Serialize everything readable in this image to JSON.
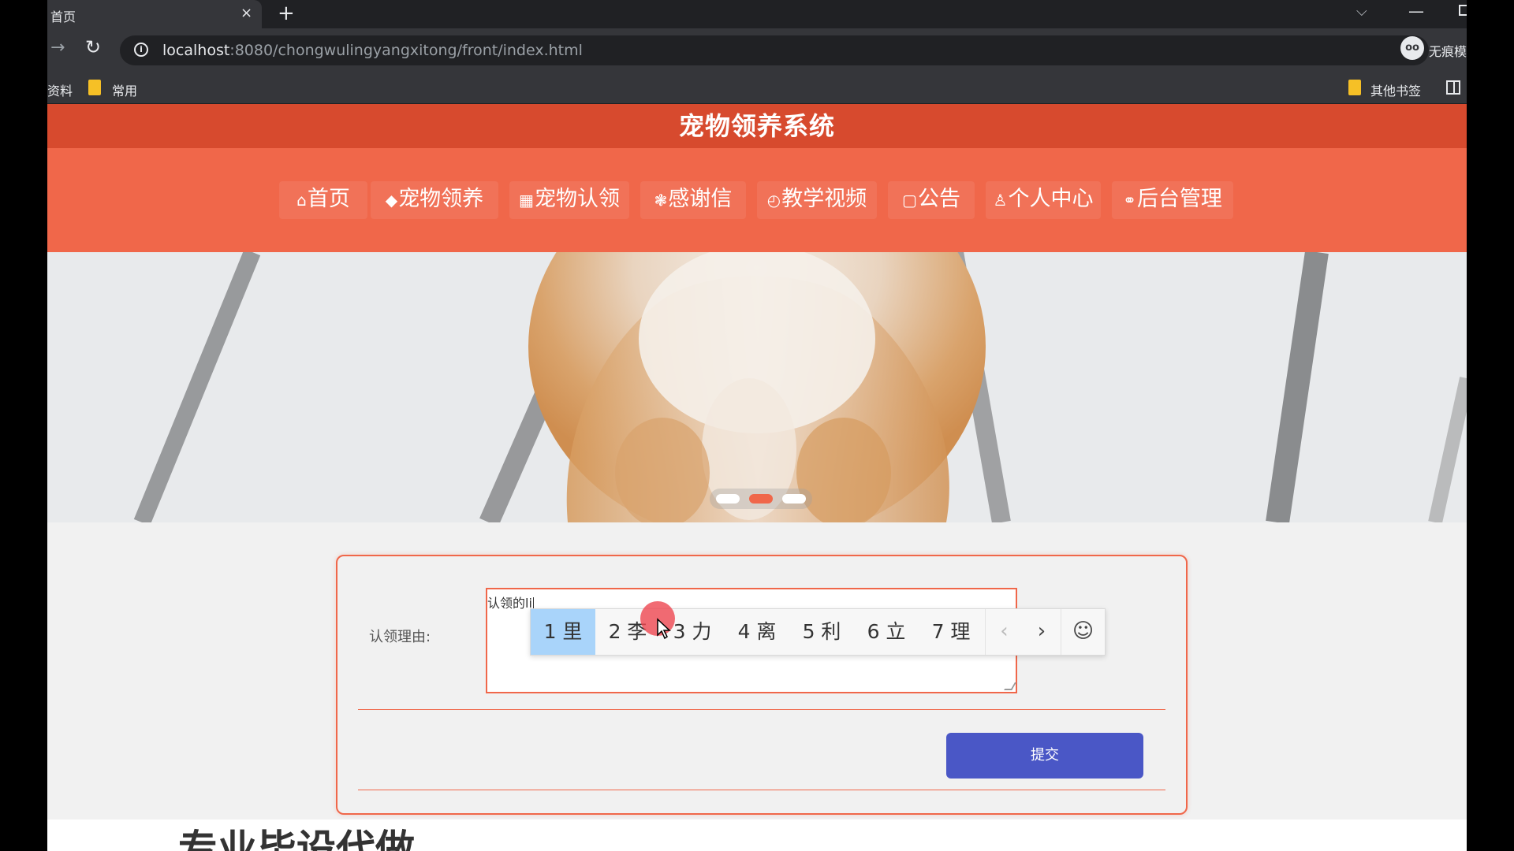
{
  "browser": {
    "tab_title": "首页",
    "tab_close": "×",
    "new_tab": "+",
    "url_host": "localhost",
    "url_rest": ":8080/chongwulingyangxitong/front/index.html",
    "profile_badge": "oo",
    "profile_label": "无痕模",
    "bookmarks": [
      {
        "label": "资料"
      },
      {
        "label": "常用"
      }
    ],
    "other_bookmarks": "其他书签"
  },
  "site": {
    "title": "宠物领养系统",
    "nav": [
      {
        "icon": "⌂",
        "label": "首页",
        "active": false
      },
      {
        "icon": "◆",
        "label": "宠物领养",
        "active": true
      },
      {
        "icon": "▦",
        "label": "宠物认领",
        "active": false
      },
      {
        "icon": "❃",
        "label": "感谢信",
        "active": false
      },
      {
        "icon": "◴",
        "label": "教学视频",
        "active": false
      },
      {
        "icon": "▢",
        "label": "公告",
        "active": false
      },
      {
        "icon": "♙",
        "label": "个人中心",
        "active": false
      },
      {
        "icon": "⚭",
        "label": "后台管理",
        "active": false
      }
    ],
    "carousel": {
      "slide_count": 3,
      "active_index": 1
    }
  },
  "form": {
    "reason_label": "认领理由:",
    "reason_value": "认领的li",
    "submit_label": "提交"
  },
  "ime": {
    "candidates": [
      "1 里",
      "2 李",
      "3 力",
      "4 离",
      "5 利",
      "6 立",
      "7 理"
    ],
    "selected_index": 0,
    "prev_label": "‹",
    "next_label": "›",
    "emoji_label": "☺"
  },
  "section": {
    "title": "专业毕设代做"
  },
  "colors": {
    "header": "#d74a2e",
    "nav": "#f0674a",
    "nav_active": "#d2422a",
    "submit": "#4a57c6",
    "ime_selected": "#a9d4fa"
  }
}
